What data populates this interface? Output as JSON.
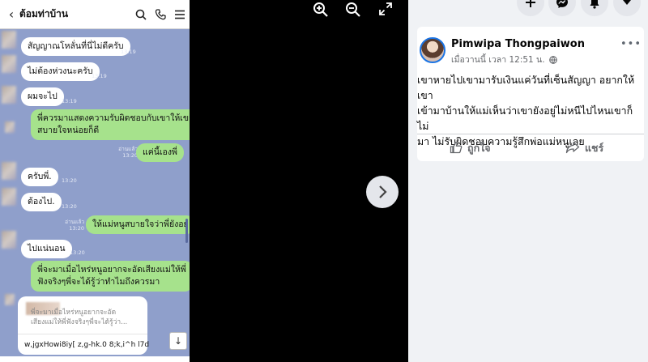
{
  "chat": {
    "title": "ต้อมท่าบ้าน",
    "back_icon": "back-arrow-icon",
    "header_icons": [
      "search-icon",
      "phone-icon",
      "menu-icon"
    ],
    "messages": [
      {
        "text": "สัญญาณโหลั่นที่นี่ไม่ดีครับ",
        "time": "13:19",
        "from": "them"
      },
      {
        "text": "ไม่ต้องห่วงนะครับ",
        "time": "13:19",
        "from": "them"
      },
      {
        "text": "ผมจะไป",
        "time": "13:19",
        "from": "them"
      },
      {
        "text_line1": "พี่ควรมาแสดงความรับผิดชอบกับเขาให้เขา",
        "text_line2": "สบายใจหน่อยก็ดี",
        "from": "me"
      },
      {
        "text": "แค่นี้เองพี่",
        "read": "อ่านแล้ว",
        "time": "13:20",
        "from": "me"
      },
      {
        "text": "ครับพี่.",
        "time": "13:20",
        "from": "them"
      },
      {
        "text": "ต้องไป.",
        "time": "13:20",
        "from": "them"
      },
      {
        "text": "ให้แม่หนูสบายใจว่าพี่ยังอยู่",
        "read": "อ่านแล้ว",
        "time": "13:20",
        "from": "me"
      },
      {
        "text": "ไปแน่นอน",
        "time": "13:20",
        "from": "them"
      },
      {
        "text_line1": "พี่จะมาเมื่อไหร่หนูอยากจะอัดเสียงแม่ให้พี่",
        "text_line2": "ฟังจริงๆพี่จะได้รู้ว่าทำไมถึงควรมา",
        "from": "me"
      }
    ],
    "reply_preview": {
      "line1": "พี่จะมาเมื่อไหร่หนูอยากจะอัด",
      "line2": "เสียงแม่ให้พี่ฟังจริงๆพี่จะได้รู้ว่า..."
    },
    "input_text": "w,jgxHowi8iy[ z,g-hk.0 8;k,i^h l7d",
    "scroll_button_icon": "arrow-down-icon"
  },
  "viewer": {
    "zoom_in_icon": "zoom-in-icon",
    "zoom_out_icon": "zoom-out-icon",
    "fullscreen_icon": "fullscreen-icon",
    "next_icon": "chevron-right-icon"
  },
  "post": {
    "author": "Pimwipa Thongpaiwon",
    "time": "เมื่อวานนี้ เวลา 12:51 น.",
    "audience_icon": "globe-icon",
    "body_line1": "เขาหายไปเขามารับเงินแค่วันที่เซ็นสัญญา อยากให้เขา",
    "body_line2": "เข้ามาบ้านให้แม่เห็นว่าเขายังอยู่ไม่หนีไปไหนเขาก็ไม่",
    "body_line3": "มา ไม่รับผิดชอบความรู้สึกพ่อแม่หนูเลย",
    "like_label": "ถูกใจ",
    "share_label": "แชร์"
  },
  "topbar": {
    "icons": [
      "plus-icon",
      "messenger-icon",
      "notifications-icon",
      "account-menu-icon"
    ]
  },
  "colors": {
    "chat_bg": "#8f9fcb",
    "bubble_in": "#ffffff",
    "bubble_out": "#a6e28c",
    "fb_blue": "#1b74e4",
    "fb_gray_bg": "#f0f2f5"
  }
}
